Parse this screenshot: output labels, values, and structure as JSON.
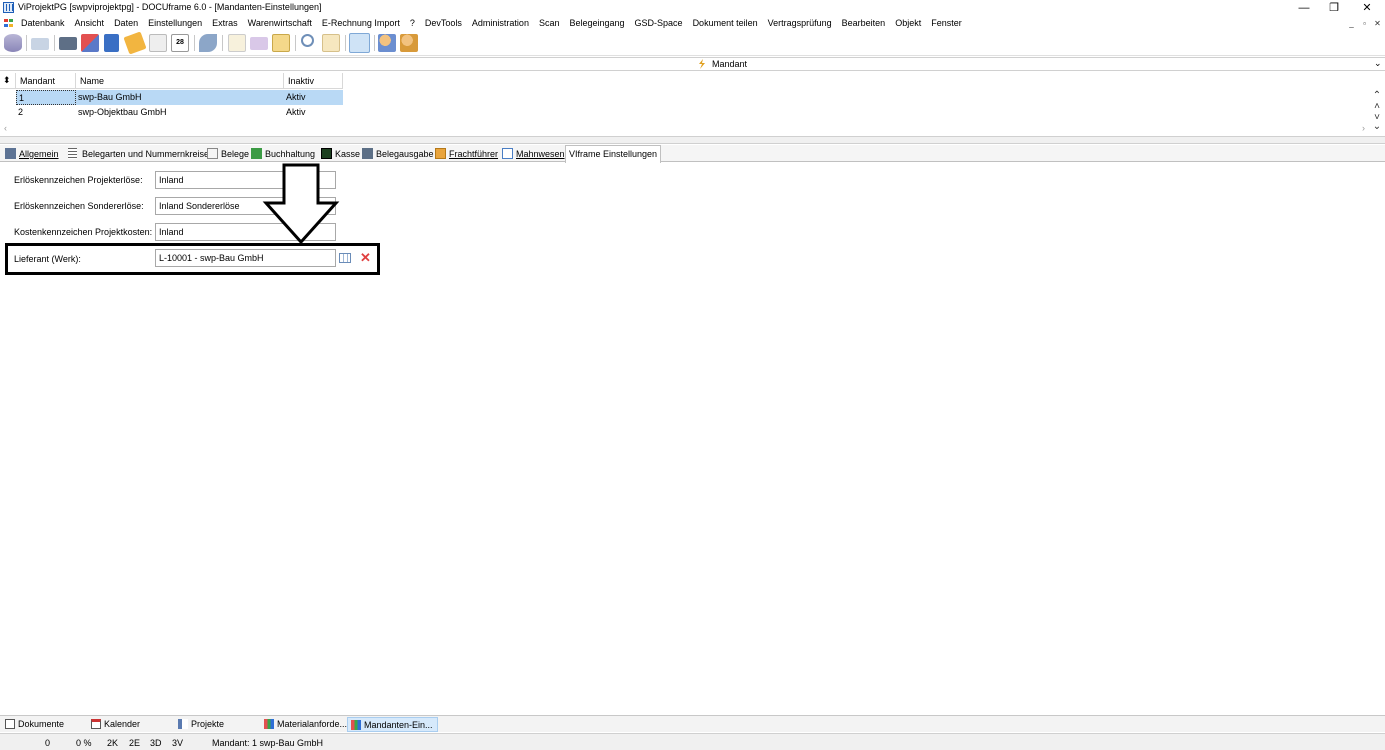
{
  "window": {
    "title": "ViProjektPG [swpviprojektpg] - DOCUframe 6.0 - [Mandanten-Einstellungen]",
    "minimize": "—",
    "maximize": "❐",
    "close": "✕"
  },
  "menu": {
    "items": [
      "Datenbank",
      "Ansicht",
      "Daten",
      "Einstellungen",
      "Extras",
      "Warenwirtschaft",
      "E-Rechnung Import",
      "?",
      "DevTools",
      "Administration",
      "Scan",
      "Belegeingang",
      "GSD-Space",
      "Dokument teilen",
      "Vertragsprüfung",
      "Bearbeiten",
      "Objekt",
      "Fenster"
    ],
    "mdi_minimize": "_",
    "mdi_restore": "▫",
    "mdi_close": "✕"
  },
  "combo": {
    "label": "Mandant",
    "icon": "lightning-icon"
  },
  "grid": {
    "columns": [
      "Mandant",
      "Name",
      "Inaktiv"
    ],
    "rows": [
      {
        "mandant": "1",
        "name": "swp-Bau GmbH",
        "inaktiv": "Aktiv"
      },
      {
        "mandant": "2",
        "name": "swp-Objektbau GmbH",
        "inaktiv": "Aktiv"
      }
    ]
  },
  "tabs": [
    {
      "label": "Allgemein",
      "icon": "people-icon"
    },
    {
      "label": "Belegarten und Nummernkreise",
      "icon": "list-icon"
    },
    {
      "label": "Belege",
      "icon": "document-icon"
    },
    {
      "label": "Buchhaltung",
      "icon": "chart-icon"
    },
    {
      "label": "Kasse",
      "icon": "register-icon"
    },
    {
      "label": "Belegausgabe",
      "icon": "output-icon"
    },
    {
      "label": "Frachtführer",
      "icon": "box-icon"
    },
    {
      "label": "Mahnwesen",
      "icon": "calendar-icon"
    },
    {
      "label": "VIframe Einstellungen",
      "icon": ""
    }
  ],
  "form": {
    "fields": [
      {
        "label": "Erlöskennzeichen Projekterlöse:",
        "value": "Inland"
      },
      {
        "label": "Erlöskennzeichen Sondererlöse:",
        "value": "Inland Sondererlöse"
      },
      {
        "label": "Kostenkennzeichen Projektkosten:",
        "value": "Inland"
      },
      {
        "label": "Lieferant (Werk):",
        "value": "L-10001 - swp-Bau GmbH"
      }
    ]
  },
  "taskbar": [
    {
      "label": "Dokumente",
      "icon": "documents-icon"
    },
    {
      "label": "Kalender",
      "icon": "calendar-icon"
    },
    {
      "label": "Projekte",
      "icon": "projects-icon"
    },
    {
      "label": "Materialanforde...",
      "icon": "grid-icon"
    },
    {
      "label": "Mandanten-Ein...",
      "icon": "grid-icon"
    }
  ],
  "status": {
    "count": "0",
    "percent": "0 %",
    "k": "2K",
    "e": "2E",
    "d": "3D",
    "v": "3V",
    "mandant": "Mandant: 1 swp-Bau GmbH"
  }
}
